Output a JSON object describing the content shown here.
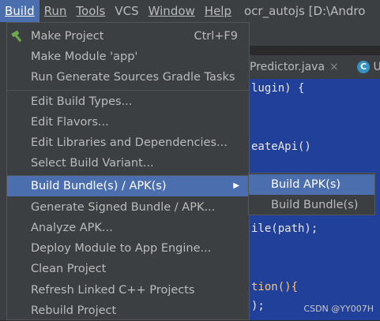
{
  "menubar": {
    "items": [
      "Build",
      "Run",
      "Tools",
      "VCS",
      "Window",
      "Help"
    ],
    "mnemonics": [
      "B",
      "R",
      "T",
      "",
      "W",
      "H"
    ],
    "project_title": "ocr_autojs [D:\\Andro"
  },
  "editor": {
    "left_tab_fragment": "oc",
    "tab_file": "Predictor.java",
    "tab_close": "×",
    "second_tab_icon": "C",
    "second_tab_fragment": "U",
    "code_lines": [
      "lugin) {",
      "eateApi()",
      "ile(path);",
      "tion(){",
      ");"
    ],
    "watermark": "CSDN @YY007H"
  },
  "build_menu": {
    "items": [
      {
        "label": "Make Project",
        "shortcut": "Ctrl+F9",
        "icon": "hammer-icon"
      },
      {
        "label": "Make Module 'app'",
        "shortcut": ""
      },
      {
        "label": "Run Generate Sources Gradle Tasks",
        "shortcut": ""
      },
      {
        "label": "Edit Build Types...",
        "shortcut": ""
      },
      {
        "label": "Edit Flavors...",
        "shortcut": ""
      },
      {
        "label": "Edit Libraries and Dependencies...",
        "shortcut": ""
      },
      {
        "label": "Select Build Variant...",
        "shortcut": ""
      },
      {
        "label": "Build Bundle(s) / APK(s)",
        "shortcut": "",
        "submenu": true,
        "selected": true
      },
      {
        "label": "Generate Signed Bundle / APK...",
        "shortcut": ""
      },
      {
        "label": "Analyze APK...",
        "shortcut": ""
      },
      {
        "label": "Deploy Module to App Engine...",
        "shortcut": ""
      },
      {
        "label": "Clean Project",
        "shortcut": ""
      },
      {
        "label": "Refresh Linked C++ Projects",
        "shortcut": ""
      },
      {
        "label": "Rebuild Project",
        "shortcut": ""
      }
    ],
    "submenu_arrow": "▶"
  },
  "submenu": {
    "items": [
      {
        "label": "Build APK(s)",
        "selected": true
      },
      {
        "label": "Build Bundle(s)",
        "selected": false
      }
    ]
  },
  "colors": {
    "menu_bg": "#3c3f41",
    "selection": "#4b6eaf",
    "editor_selection": "#21409a",
    "hammer_green": "#6fa84b"
  }
}
